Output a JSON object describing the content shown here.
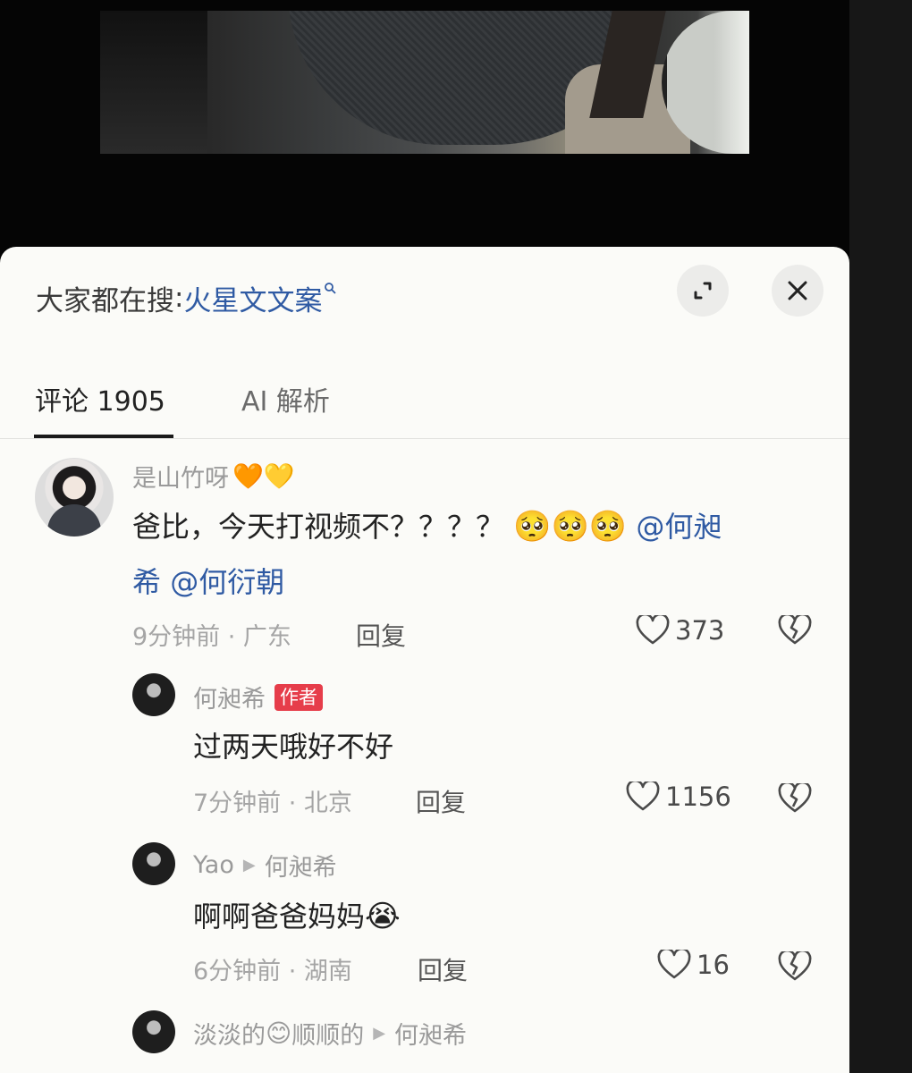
{
  "header": {
    "search_prefix": "大家都在搜",
    "search_colon": ":",
    "search_term": "火星文文案"
  },
  "tabs": {
    "comments_label": "评论 1905",
    "ai_label": "AI 解析"
  },
  "icons": {
    "expand": "expand-icon",
    "close": "close-icon",
    "like": "heart-outline-icon",
    "dislike": "broken-heart-icon",
    "search": "search-icon"
  },
  "colors": {
    "mention": "#2f5aa3",
    "author_badge": "#e63d4a"
  },
  "comments": [
    {
      "user": "是山竹呀",
      "user_emojis": "🧡💛",
      "text": "爸比，今天打视频不？？？？",
      "emojis": "🥺🥺🥺",
      "mention1": "@何昶",
      "mention1_wrap": "希",
      "mention2": "@何衍朝",
      "time": "9分钟前 · 广东",
      "reply": "回复",
      "likes": "373"
    },
    {
      "user": "何昶希",
      "badge": "作者",
      "text": "过两天哦好不好",
      "time": "7分钟前 · 北京",
      "reply": "回复",
      "likes": "1156"
    },
    {
      "user": "Yao",
      "reply_to": "何昶希",
      "text": "啊啊爸爸妈妈",
      "emoji": "😭",
      "time": "6分钟前 · 湖南",
      "reply": "回复",
      "likes": "16"
    },
    {
      "user_part1": "淡淡的",
      "user_emoji": "😊",
      "user_part2": "顺顺的",
      "reply_to": "何昶希"
    }
  ]
}
